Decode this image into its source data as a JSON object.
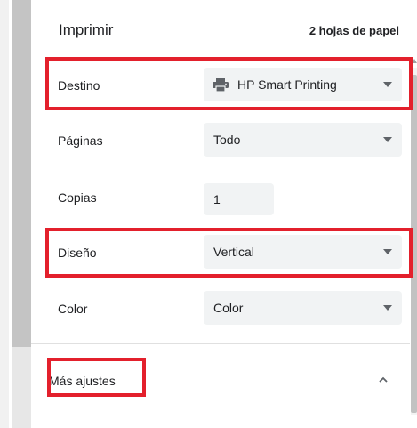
{
  "header": {
    "title": "Imprimir",
    "sheets": "2 hojas de papel"
  },
  "rows": {
    "destination": {
      "label": "Destino",
      "value": "HP Smart Printing",
      "icon": "printer-icon"
    },
    "pages": {
      "label": "Páginas",
      "value": "Todo"
    },
    "copies": {
      "label": "Copias",
      "value": "1"
    },
    "layout": {
      "label": "Diseño",
      "value": "Vertical"
    },
    "color": {
      "label": "Color",
      "value": "Color"
    }
  },
  "more_settings": {
    "label": "Más ajustes",
    "icon": "chevron-up-icon"
  },
  "colors": {
    "annotation": "#e3202c",
    "select_background": "#f1f3f4",
    "text": "#202124",
    "icon": "#5f6368"
  }
}
